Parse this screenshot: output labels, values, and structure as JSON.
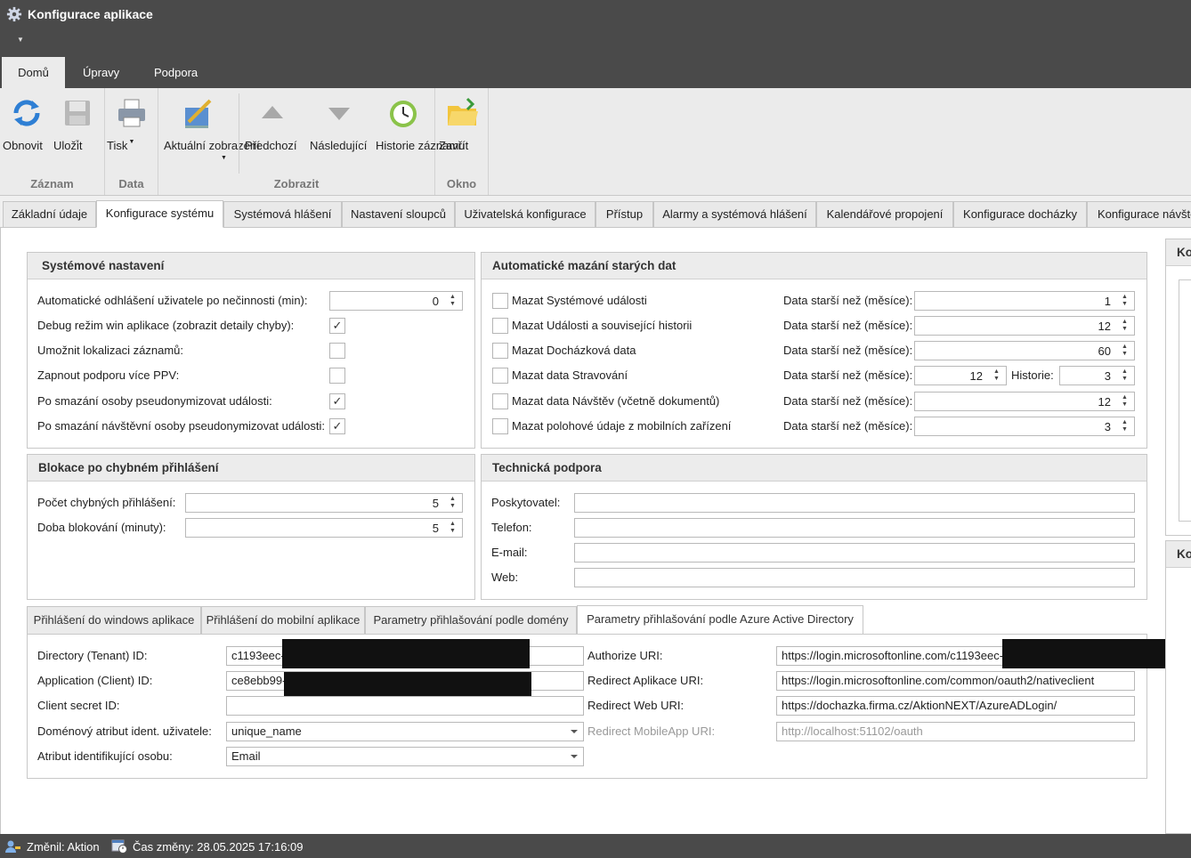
{
  "window": {
    "title": "Konfigurace aplikace"
  },
  "ribbon_tabs": [
    "Domů",
    "Úpravy",
    "Podpora"
  ],
  "ribbon": {
    "buttons": {
      "refresh": "Obnovit",
      "save": "Uložit",
      "print": "Tisk",
      "current_view": "Aktuální zobrazení",
      "previous": "Předchozí",
      "next": "Následující",
      "history": "Historie záznamu",
      "close": "Zavřít"
    },
    "groups": {
      "record": "Záznam",
      "data": "Data",
      "view": "Zobrazit",
      "window": "Okno"
    }
  },
  "main_tabs": [
    "Základní údaje",
    "Konfigurace systému",
    "Systémová hlášení",
    "Nastavení sloupců",
    "Uživatelská konfigurace",
    "Přístup",
    "Alarmy a systémová hlášení",
    "Kalendářové propojení",
    "Konfigurace docházky",
    "Konfigurace návště"
  ],
  "system_settings": {
    "title": "Systémové nastavení",
    "auto_logout_label": "Automatické odhlášení uživatele po nečinnosti (min):",
    "auto_logout_value": "0",
    "debug_label": "Debug režim win aplikace (zobrazit detaily chyby):",
    "localization_label": "Umožnit lokalizaci záznamů:",
    "ppv_label": "Zapnout podporu více PPV:",
    "pseudo_person_label": "Po smazání osoby pseudonymizovat události:",
    "pseudo_visitor_label": "Po smazání návštěvní osoby pseudonymizovat události:",
    "checked": {
      "debug": true,
      "localization": false,
      "ppv": false,
      "pseudo_person": true,
      "pseudo_visitor": true
    }
  },
  "auto_delete": {
    "title": "Automatické mazání starých dat",
    "older_label": "Data starší než (měsíce):",
    "history_label": "Historie:",
    "rows": [
      {
        "label": "Mazat Systémové události",
        "value": "1"
      },
      {
        "label": "Mazat Události a související historii",
        "value": "12"
      },
      {
        "label": "Mazat Docházková data",
        "value": "60"
      },
      {
        "label": "Mazat data Stravování",
        "value": "12",
        "history": "3"
      },
      {
        "label": "Mazat data Návštěv (včetně dokumentů)",
        "value": "12"
      },
      {
        "label": "Mazat polohové údaje z mobilních zařízení",
        "value": "3"
      }
    ]
  },
  "login_block": {
    "title": "Blokace po chybném přihlášení",
    "attempts_label": "Počet chybných přihlášení:",
    "attempts_value": "5",
    "duration_label": "Doba blokování (minuty):",
    "duration_value": "5"
  },
  "tech_support": {
    "title": "Technická podpora",
    "provider_label": "Poskytovatel:",
    "phone_label": "Telefon:",
    "email_label": "E-mail:",
    "web_label": "Web:"
  },
  "login_tabs": [
    "Přihlášení do windows aplikace",
    "Přihlášení do mobilní aplikace",
    "Parametry přihlašování podle domény",
    "Parametry přihlašování podle Azure Active Directory"
  ],
  "azure": {
    "tenant_label": "Directory (Tenant) ID:",
    "tenant_value": "c1193eec-",
    "client_label": "Application (Client) ID:",
    "client_value": "ce8ebb99-",
    "secret_label": "Client secret ID:",
    "secret_value": "",
    "domain_attr_label": "Doménový atribut ident. uživatele:",
    "domain_attr_value": "unique_name",
    "person_attr_label": "Atribut identifikující osobu:",
    "person_attr_value": "Email",
    "authorize_label": "Authorize URI:",
    "authorize_value": "https://login.microsoftonline.com/c1193eec-",
    "redirect_app_label": "Redirect Aplikace URI:",
    "redirect_app_value": "https://login.microsoftonline.com/common/oauth2/nativeclient",
    "redirect_web_label": "Redirect Web URI:",
    "redirect_web_value": "https://dochazka.firma.cz/AktionNEXT/AzureADLogin/",
    "redirect_mobile_label": "Redirect MobileApp URI:",
    "redirect_mobile_value": "http://localhost:51102/oauth"
  },
  "right_panel": {
    "head1": "Ko",
    "head2": "Ko"
  },
  "status": {
    "changed_by": "Změnil: Aktion",
    "changed_at": "Čas změny: 28.05.2025 17:16:09"
  }
}
